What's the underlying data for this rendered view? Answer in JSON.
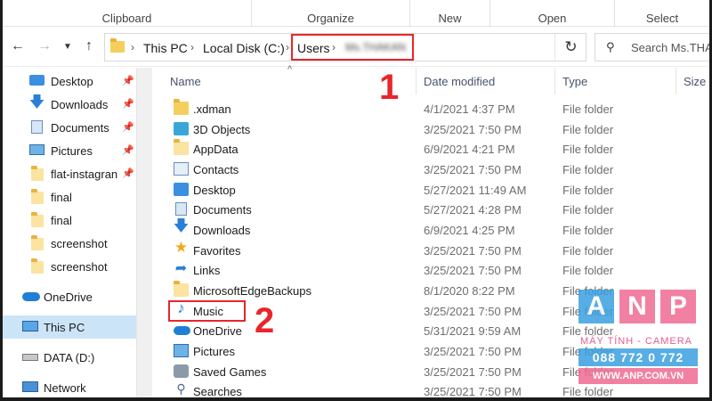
{
  "ribbon": {
    "groups": [
      "Clipboard",
      "Organize",
      "New",
      "Open",
      "Select"
    ]
  },
  "address": {
    "crumbs": [
      "This PC",
      "Local Disk (C:)",
      "Users",
      "Ms.THAKAN"
    ],
    "search_placeholder": "Search Ms.THAKAN"
  },
  "sidebar": {
    "items": [
      {
        "label": "Desktop",
        "icon": "desktop-icon",
        "pinned": true
      },
      {
        "label": "Downloads",
        "icon": "download-icon",
        "pinned": true
      },
      {
        "label": "Documents",
        "icon": "documents-icon",
        "pinned": true
      },
      {
        "label": "Pictures",
        "icon": "pictures-icon",
        "pinned": true
      },
      {
        "label": "flat-instagran",
        "icon": "folder-icon",
        "pinned": true
      },
      {
        "label": "final",
        "icon": "folder-icon",
        "pinned": false
      },
      {
        "label": "final",
        "icon": "folder-icon",
        "pinned": false
      },
      {
        "label": "screenshot",
        "icon": "folder-icon",
        "pinned": false
      },
      {
        "label": "screenshot",
        "icon": "folder-icon",
        "pinned": false
      },
      {
        "label": "OneDrive",
        "icon": "onedrive-icon",
        "pinned": false
      },
      {
        "label": "This PC",
        "icon": "this-pc-icon",
        "pinned": false,
        "selected": true
      },
      {
        "label": "DATA (D:)",
        "icon": "drive-icon",
        "pinned": false
      },
      {
        "label": "Network",
        "icon": "network-icon",
        "pinned": false
      }
    ]
  },
  "columns": {
    "name": "Name",
    "date": "Date modified",
    "type": "Type",
    "size": "Size"
  },
  "files": [
    {
      "name": ".xdman",
      "date": "4/1/2021 4:37 PM",
      "type": "File folder",
      "icon": "folder-icon"
    },
    {
      "name": "3D Objects",
      "date": "3/25/2021 7:50 PM",
      "type": "File folder",
      "icon": "3d-objects-icon"
    },
    {
      "name": "AppData",
      "date": "6/9/2021 4:21 PM",
      "type": "File folder",
      "icon": "folder-icon"
    },
    {
      "name": "Contacts",
      "date": "3/25/2021 7:50 PM",
      "type": "File folder",
      "icon": "contacts-icon"
    },
    {
      "name": "Desktop",
      "date": "5/27/2021 11:49 AM",
      "type": "File folder",
      "icon": "desktop-icon"
    },
    {
      "name": "Documents",
      "date": "5/27/2021 4:28 PM",
      "type": "File folder",
      "icon": "documents-icon"
    },
    {
      "name": "Downloads",
      "date": "6/9/2021 4:25 PM",
      "type": "File folder",
      "icon": "download-icon"
    },
    {
      "name": "Favorites",
      "date": "3/25/2021 7:50 PM",
      "type": "File folder",
      "icon": "star-icon"
    },
    {
      "name": "Links",
      "date": "3/25/2021 7:50 PM",
      "type": "File folder",
      "icon": "links-icon"
    },
    {
      "name": "MicrosoftEdgeBackups",
      "date": "8/1/2020 8:22 PM",
      "type": "File folder",
      "icon": "folder-icon"
    },
    {
      "name": "Music",
      "date": "3/25/2021 7:50 PM",
      "type": "File folder",
      "icon": "music-icon"
    },
    {
      "name": "OneDrive",
      "date": "5/31/2021 9:59 AM",
      "type": "File folder",
      "icon": "onedrive-icon"
    },
    {
      "name": "Pictures",
      "date": "3/25/2021 7:50 PM",
      "type": "File folder",
      "icon": "pictures-icon"
    },
    {
      "name": "Saved Games",
      "date": "3/25/2021 7:50 PM",
      "type": "File folder",
      "icon": "saved-games-icon"
    },
    {
      "name": "Searches",
      "date": "3/25/2021 7:50 PM",
      "type": "File folder",
      "icon": "search-icon"
    }
  ],
  "annotations": {
    "step1": "1",
    "step2": "2"
  },
  "watermark": {
    "letters": [
      "A",
      "N",
      "P"
    ],
    "tagline": "MÁY TÍNH - CAMERA",
    "phone": "088 772 0 772",
    "website": "WWW.ANP.COM.VN"
  },
  "colors": {
    "accent": "#e8262b",
    "selection": "#cce4f7",
    "folder": "#f5cf5e"
  }
}
